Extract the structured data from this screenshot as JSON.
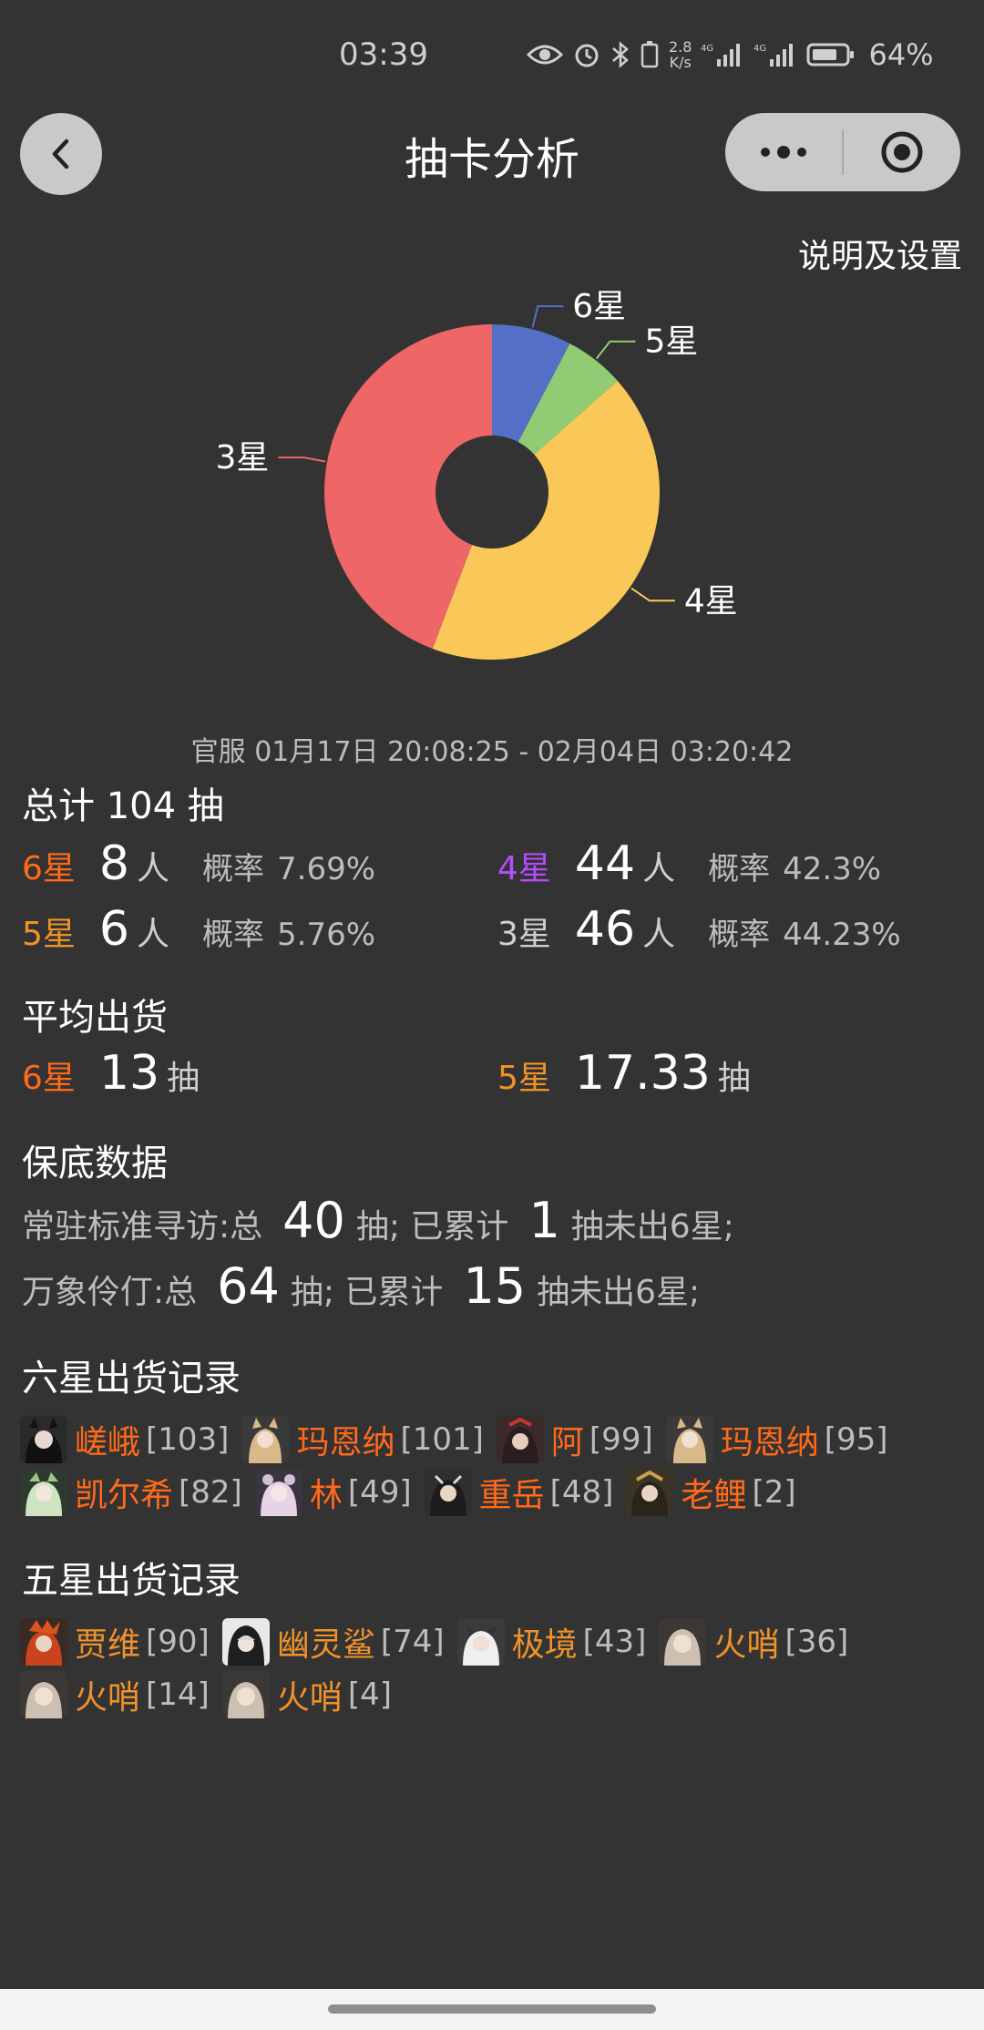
{
  "status_bar": {
    "time": "03:39",
    "net_speed_value": "2.8",
    "net_speed_unit": "K/s",
    "battery": "64%",
    "icons": [
      "eye-icon",
      "alarm-icon",
      "bluetooth-icon",
      "battery-saver-icon",
      "signal-4g-icon",
      "signal-4g-icon",
      "battery-icon"
    ]
  },
  "nav": {
    "title": "抽卡分析",
    "back_icon": "chevron-left-icon",
    "more_icon": "more-dots-icon",
    "close_icon": "target-close-icon"
  },
  "settings_link": "说明及设置",
  "chart_data": {
    "type": "pie",
    "donut": true,
    "labels": [
      "6星",
      "5星",
      "4星",
      "3星"
    ],
    "values": [
      8,
      6,
      44,
      46
    ],
    "colors": [
      "#5470c6",
      "#91cc75",
      "#fac858",
      "#ee6666"
    ]
  },
  "date_range": "官服  01月17日 20:08:25  -  02月04日 03:20:42",
  "total": {
    "title": "总计 104 抽",
    "rows": [
      {
        "label": "6星",
        "count": "8",
        "unit": "人",
        "prob_label": "概率",
        "prob": "7.69%",
        "color": "#ff6a1a"
      },
      {
        "label": "4星",
        "count": "44",
        "unit": "人",
        "prob_label": "概率",
        "prob": "42.3%",
        "color": "#b34dff"
      },
      {
        "label": "5星",
        "count": "6",
        "unit": "人",
        "prob_label": "概率",
        "prob": "5.76%",
        "color": "#f0922a"
      },
      {
        "label": "3星",
        "count": "46",
        "unit": "人",
        "prob_label": "概率",
        "prob": "44.23%",
        "color": "#cfcfcf"
      }
    ]
  },
  "average": {
    "title": "平均出货",
    "six_label": "6星",
    "six_value": "13",
    "six_unit": "抽",
    "five_label": "5星",
    "five_value": "17.33",
    "five_unit": "抽"
  },
  "pity": {
    "title": "保底数据",
    "rows": [
      {
        "prefix": "常驻标准寻访:总",
        "total": "40",
        "mid": "抽;  已累计",
        "current": "1",
        "suffix": "抽未出6星;"
      },
      {
        "prefix": "万象伶仃:总",
        "total": "64",
        "mid": "抽;  已累计",
        "current": "15",
        "suffix": "抽未出6星;"
      }
    ]
  },
  "six_star_records": {
    "title": "六星出货记录",
    "items": [
      {
        "name": "嵯峨",
        "count": "[103]"
      },
      {
        "name": "玛恩纳",
        "count": "[101]"
      },
      {
        "name": "阿",
        "count": "[99]"
      },
      {
        "name": "玛恩纳",
        "count": "[95]"
      },
      {
        "name": "凯尔希",
        "count": "[82]"
      },
      {
        "name": "林",
        "count": "[49]"
      },
      {
        "name": "重岳",
        "count": "[48]"
      },
      {
        "name": "老鲤",
        "count": "[2]"
      }
    ]
  },
  "five_star_records": {
    "title": "五星出货记录",
    "items": [
      {
        "name": "贾维",
        "count": "[90]"
      },
      {
        "name": "幽灵鲨",
        "count": "[74]"
      },
      {
        "name": "极境",
        "count": "[43]"
      },
      {
        "name": "火哨",
        "count": "[36]"
      },
      {
        "name": "火哨",
        "count": "[14]"
      },
      {
        "name": "火哨",
        "count": "[4]"
      }
    ]
  }
}
